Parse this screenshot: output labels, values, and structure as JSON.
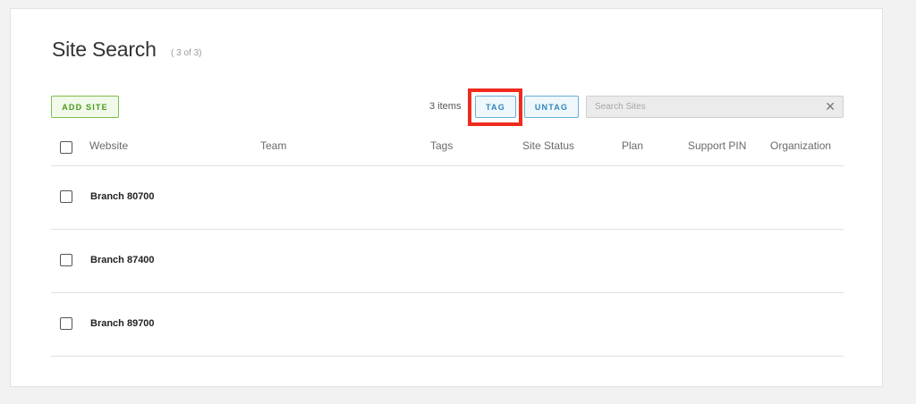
{
  "page": {
    "title": "Site Search",
    "count_text": "( 3 of 3)"
  },
  "toolbar": {
    "add_site_label": "ADD SITE",
    "items_label": "3 items",
    "tag_label": "TAG",
    "untag_label": "UNTAG",
    "search_placeholder": "Search Sites",
    "search_value": "",
    "clear_icon": "close-icon"
  },
  "table": {
    "columns": [
      "Website",
      "Team",
      "Tags",
      "Site Status",
      "Plan",
      "Support PIN",
      "Organization"
    ],
    "rows": [
      {
        "website": "Branch 80700",
        "team": "",
        "tags": "",
        "status": "",
        "plan": "",
        "pin": "",
        "organization": ""
      },
      {
        "website": "Branch 87400",
        "team": "",
        "tags": "",
        "status": "",
        "plan": "",
        "pin": "",
        "organization": ""
      },
      {
        "website": "Branch 89700",
        "team": "",
        "tags": "",
        "status": "",
        "plan": "",
        "pin": "",
        "organization": ""
      }
    ]
  },
  "colors": {
    "add_button": "#4a9a1a",
    "tag_button": "#2f86be",
    "highlight": "#ef2b1e"
  }
}
